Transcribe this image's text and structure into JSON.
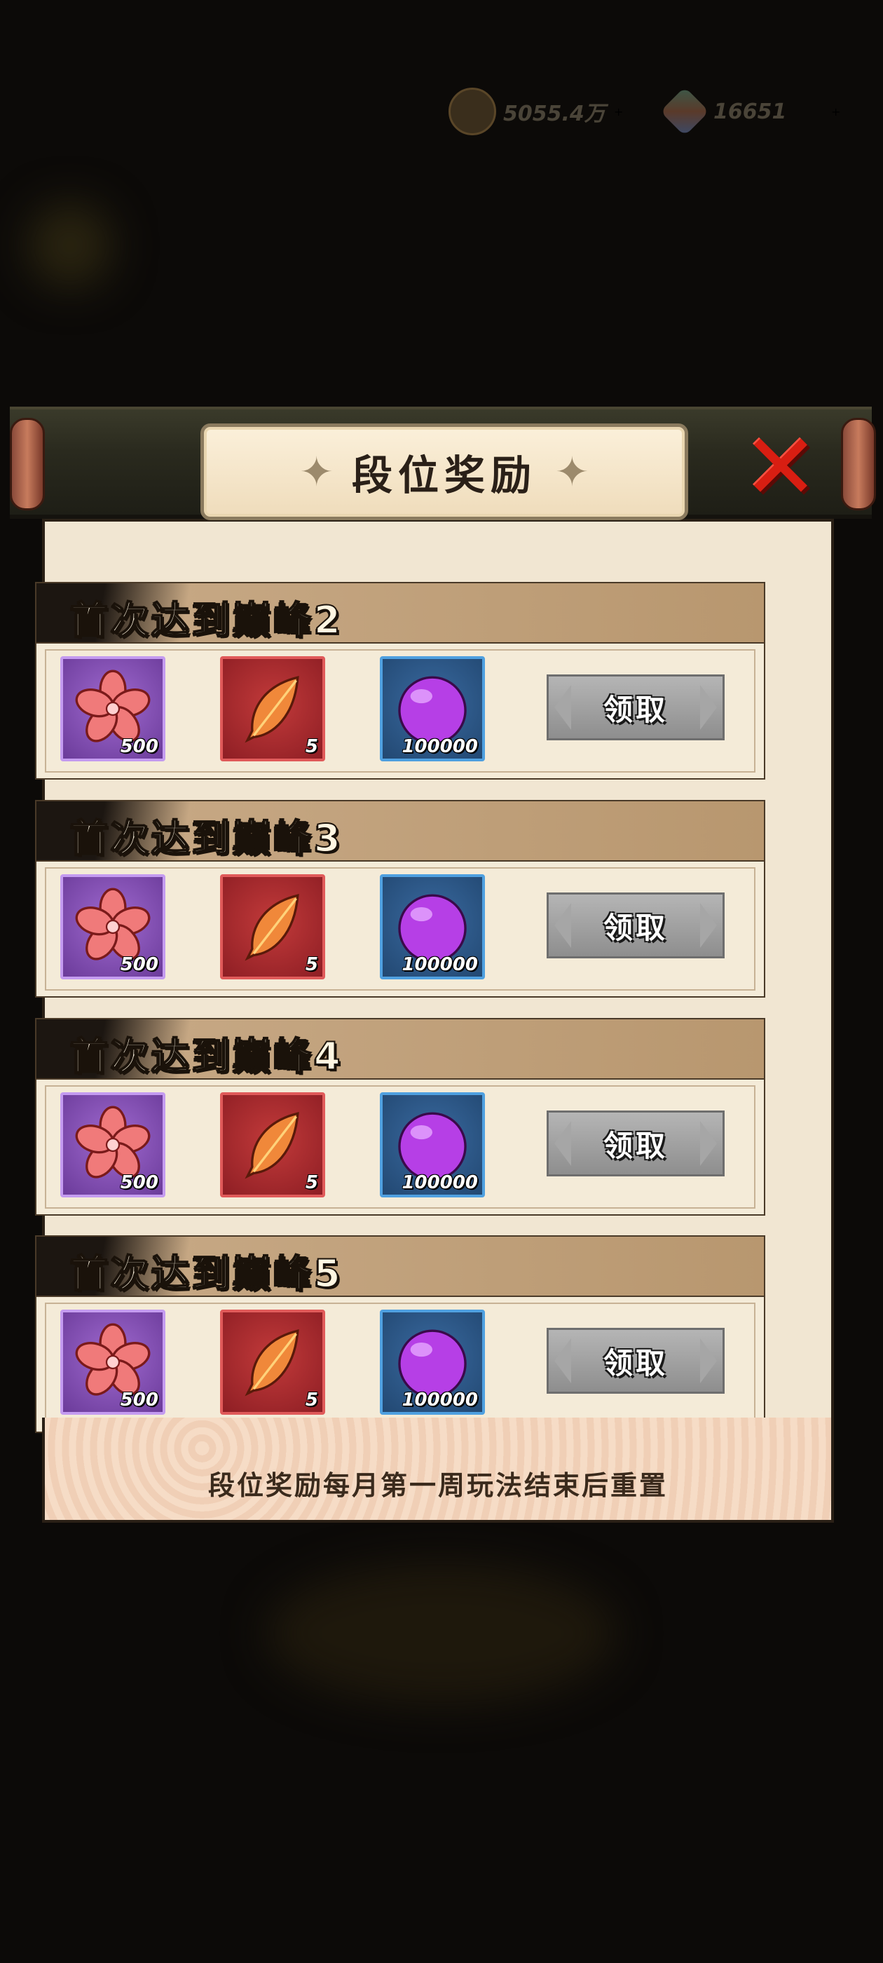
{
  "top_bar": {
    "coins": "5055.4万",
    "gems": "16651"
  },
  "dialog": {
    "title": "段位奖励",
    "footer_note": "段位奖励每月第一周玩法结束后重置",
    "rows": [
      {
        "title": "首次达到巅峰2",
        "items": [
          {
            "icon": "sakura-icon",
            "qty": "500"
          },
          {
            "icon": "feather-icon",
            "qty": "5"
          },
          {
            "icon": "purple-orb-icon",
            "qty": "100000"
          }
        ],
        "claim_label": "领取"
      },
      {
        "title": "首次达到巅峰3",
        "items": [
          {
            "icon": "sakura-icon",
            "qty": "500"
          },
          {
            "icon": "feather-icon",
            "qty": "5"
          },
          {
            "icon": "purple-orb-icon",
            "qty": "100000"
          }
        ],
        "claim_label": "领取"
      },
      {
        "title": "首次达到巅峰4",
        "items": [
          {
            "icon": "sakura-icon",
            "qty": "500"
          },
          {
            "icon": "feather-icon",
            "qty": "5"
          },
          {
            "icon": "purple-orb-icon",
            "qty": "100000"
          }
        ],
        "claim_label": "领取"
      },
      {
        "title": "首次达到巅峰5",
        "items": [
          {
            "icon": "sakura-icon",
            "qty": "500"
          },
          {
            "icon": "feather-icon",
            "qty": "5"
          },
          {
            "icon": "purple-orb-icon",
            "qty": "100000"
          }
        ],
        "claim_label": "领取"
      }
    ]
  },
  "colors": {
    "item_purple": "#7b46ad",
    "item_red": "#a8262c",
    "item_blue": "#2b5789",
    "close_red": "#d81e12"
  }
}
